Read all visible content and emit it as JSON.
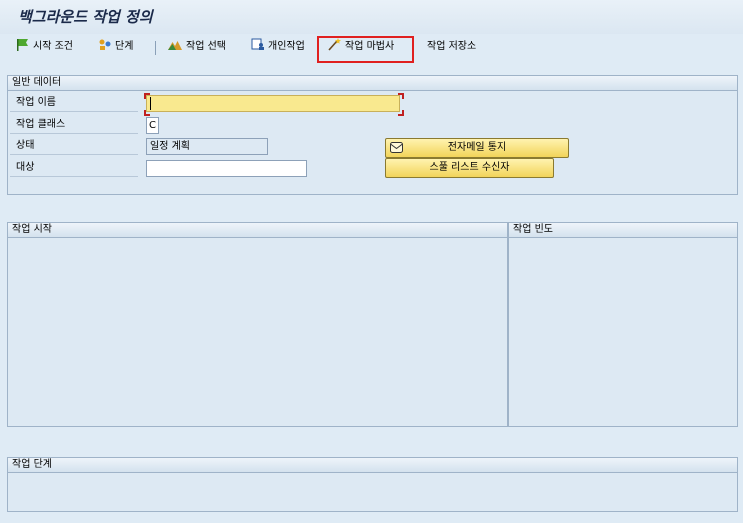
{
  "title": "백그라운드 작업 정의",
  "toolbar": {
    "start_condition": "시작 조건",
    "steps": "단계",
    "job_select": "작업 선택",
    "own_jobs": "개인작업",
    "job_wizard": "작업 마법사",
    "job_repository": "작업 저장소"
  },
  "general": {
    "header": "일반 데이터",
    "job_name_label": "작업 이름",
    "job_name_value": "",
    "job_class_label": "작업 클래스",
    "job_class_value": "C",
    "status_label": "상태",
    "status_value": "일정 계획",
    "target_label": "대상",
    "target_value": "",
    "email_button": "전자메일 통지",
    "spool_button": "스풀 리스트 수신자"
  },
  "start_panel": {
    "header": "작업 시작"
  },
  "freq_panel": {
    "header": "작업 빈도"
  },
  "steps_panel": {
    "header": "작업 단계"
  }
}
